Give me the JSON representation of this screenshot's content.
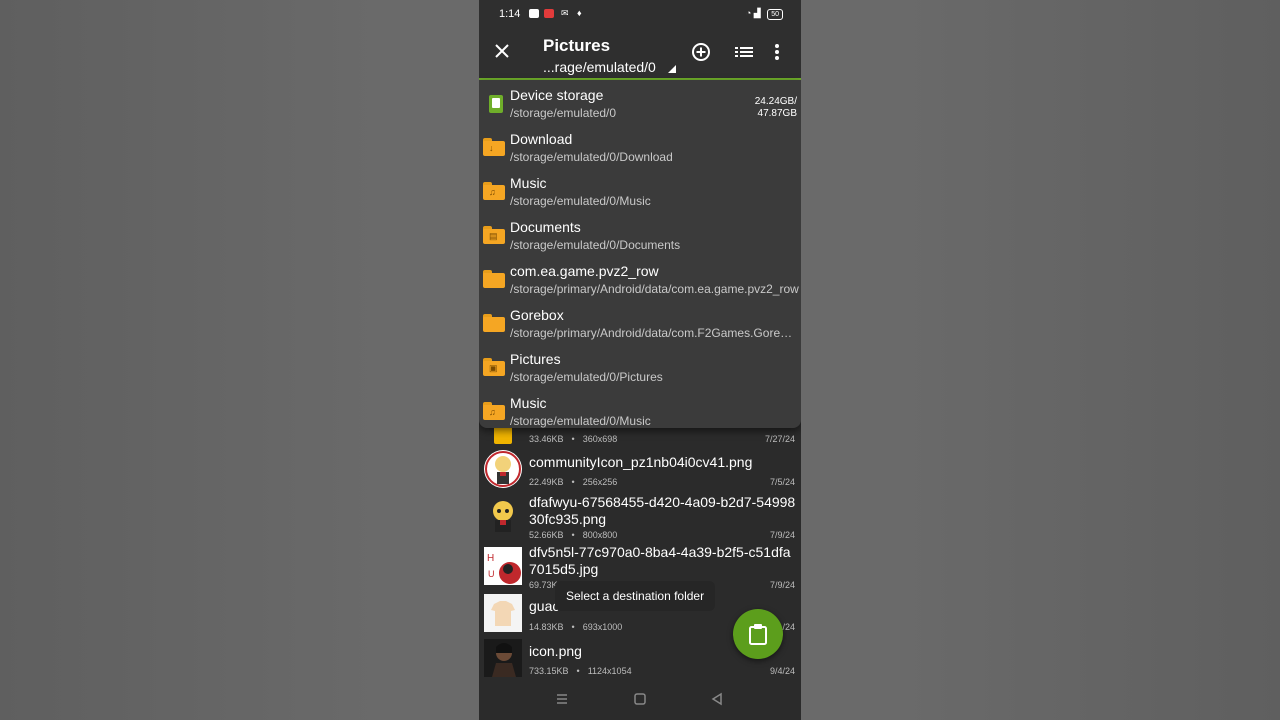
{
  "status": {
    "time": "1:14",
    "battery": "50"
  },
  "appbar": {
    "title": "Pictures",
    "path": "...rage/emulated/0"
  },
  "dropdown": [
    {
      "name": "Device storage",
      "path": "/storage/emulated/0",
      "size_used": "24.24GB/",
      "size_total": "47.87GB",
      "icon": "sd-card-icon"
    },
    {
      "name": "Download",
      "path": "/storage/emulated/0/Download",
      "icon": "download-folder-icon"
    },
    {
      "name": "Music",
      "path": "/storage/emulated/0/Music",
      "icon": "music-folder-icon"
    },
    {
      "name": "Documents",
      "path": "/storage/emulated/0/Documents",
      "icon": "documents-folder-icon"
    },
    {
      "name": "com.ea.game.pvz2_row",
      "path": "/storage/primary/Android/data/com.ea.game.pvz2_row",
      "icon": "folder-icon"
    },
    {
      "name": "Gorebox",
      "path": "/storage/primary/Android/data/com.F2Games.GoreBox",
      "icon": "folder-icon"
    },
    {
      "name": "Pictures",
      "path": "/storage/emulated/0/Pictures",
      "icon": "pictures-folder-icon"
    },
    {
      "name": "Music",
      "path": "/storage/emulated/0/Music",
      "icon": "music-folder-icon"
    }
  ],
  "files": [
    {
      "name": "",
      "size": "33.46KB",
      "dims": "360x698",
      "date": "7/27/24"
    },
    {
      "name": "communityIcon_pz1nb04i0cv41.png",
      "size": "22.49KB",
      "dims": "256x256",
      "date": "7/5/24"
    },
    {
      "name": "dfafwyu-67568455-d420-4a09-b2d7-5499830fc935.png",
      "size": "52.66KB",
      "dims": "800x800",
      "date": "7/9/24"
    },
    {
      "name": "dfv5n5l-77c970a0-8ba4-4a39-b2f5-c51dfa7015d5.jpg",
      "size": "69.73K",
      "dims": "",
      "date": "7/9/24"
    },
    {
      "name": "guac",
      "size": "14.83KB",
      "dims": "693x1000",
      "date": "/24"
    },
    {
      "name": "icon.png",
      "size": "733.15KB",
      "dims": "1124x1054",
      "date": "9/4/24"
    }
  ],
  "toast": "Select a destination folder",
  "colors": {
    "accent": "#6fae2a",
    "fab": "#5c9e1c",
    "folder": "#f5a623"
  }
}
